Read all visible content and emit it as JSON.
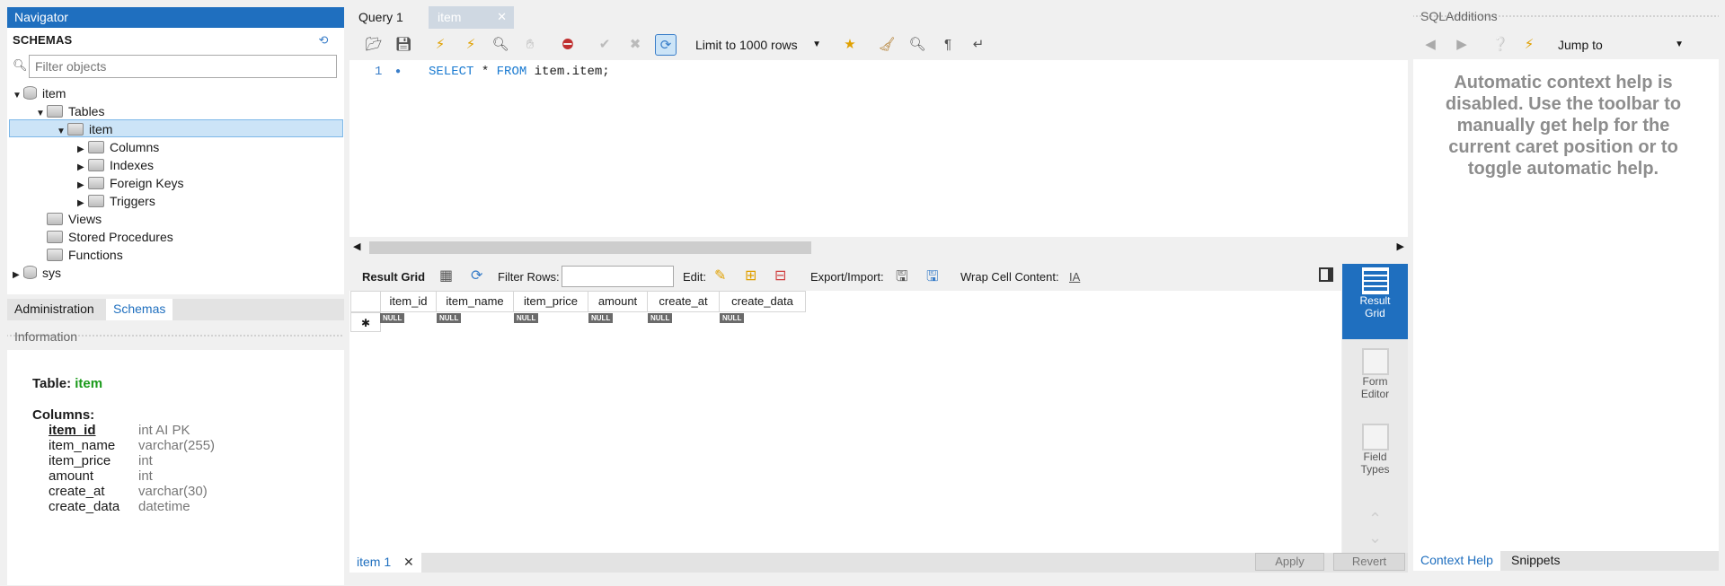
{
  "navigator": {
    "title": "Navigator",
    "schemas_header": "SCHEMAS",
    "filter_placeholder": "Filter objects",
    "tree": {
      "db_item": "item",
      "tables": "Tables",
      "table_item": "item",
      "columns": "Columns",
      "indexes": "Indexes",
      "foreign_keys": "Foreign Keys",
      "triggers": "Triggers",
      "views": "Views",
      "stored_procedures": "Stored Procedures",
      "functions": "Functions",
      "db_sys": "sys"
    },
    "tabs": {
      "administration": "Administration",
      "schemas": "Schemas"
    }
  },
  "information": {
    "title": "Information",
    "table_label": "Table:",
    "table_name": "item",
    "columns_label": "Columns:",
    "columns": [
      {
        "name": "item_id",
        "type": "int AI PK"
      },
      {
        "name": "item_name",
        "type": "varchar(255)"
      },
      {
        "name": "item_price",
        "type": "int"
      },
      {
        "name": "amount",
        "type": "int"
      },
      {
        "name": "create_at",
        "type": "varchar(30)"
      },
      {
        "name": "create_data",
        "type": "datetime"
      }
    ]
  },
  "editor": {
    "tabs": {
      "query1": "Query 1",
      "item": "item"
    },
    "limit_label": "Limit to 1000 rows",
    "line_number": "1",
    "sql": {
      "kw_select": "SELECT",
      "star": "*",
      "kw_from": "FROM",
      "rest": "item.item;"
    }
  },
  "results": {
    "result_grid_label": "Result Grid",
    "filter_rows_label": "Filter Rows:",
    "edit_label": "Edit:",
    "export_label": "Export/Import:",
    "wrap_label": "Wrap Cell Content:",
    "columns": [
      "item_id",
      "item_name",
      "item_price",
      "amount",
      "create_at",
      "create_data"
    ],
    "null_label": "NULL",
    "side_buttons": {
      "result_grid": [
        "Result",
        "Grid"
      ],
      "form_editor": [
        "Form",
        "Editor"
      ],
      "field_types": [
        "Field",
        "Types"
      ]
    },
    "bottom_tab": "item 1",
    "apply": "Apply",
    "revert": "Revert"
  },
  "sql_additions": {
    "title": "SQLAdditions",
    "jump_to": "Jump to",
    "help_text": "Automatic context help is disabled. Use the toolbar to manually get help for the current caret position or to toggle automatic help.",
    "tabs": {
      "context_help": "Context Help",
      "snippets": "Snippets"
    }
  },
  "colors": {
    "accent": "#1f6fbf",
    "keyword": "#1b7bd1",
    "table_name_green": "#1a9a1a"
  }
}
